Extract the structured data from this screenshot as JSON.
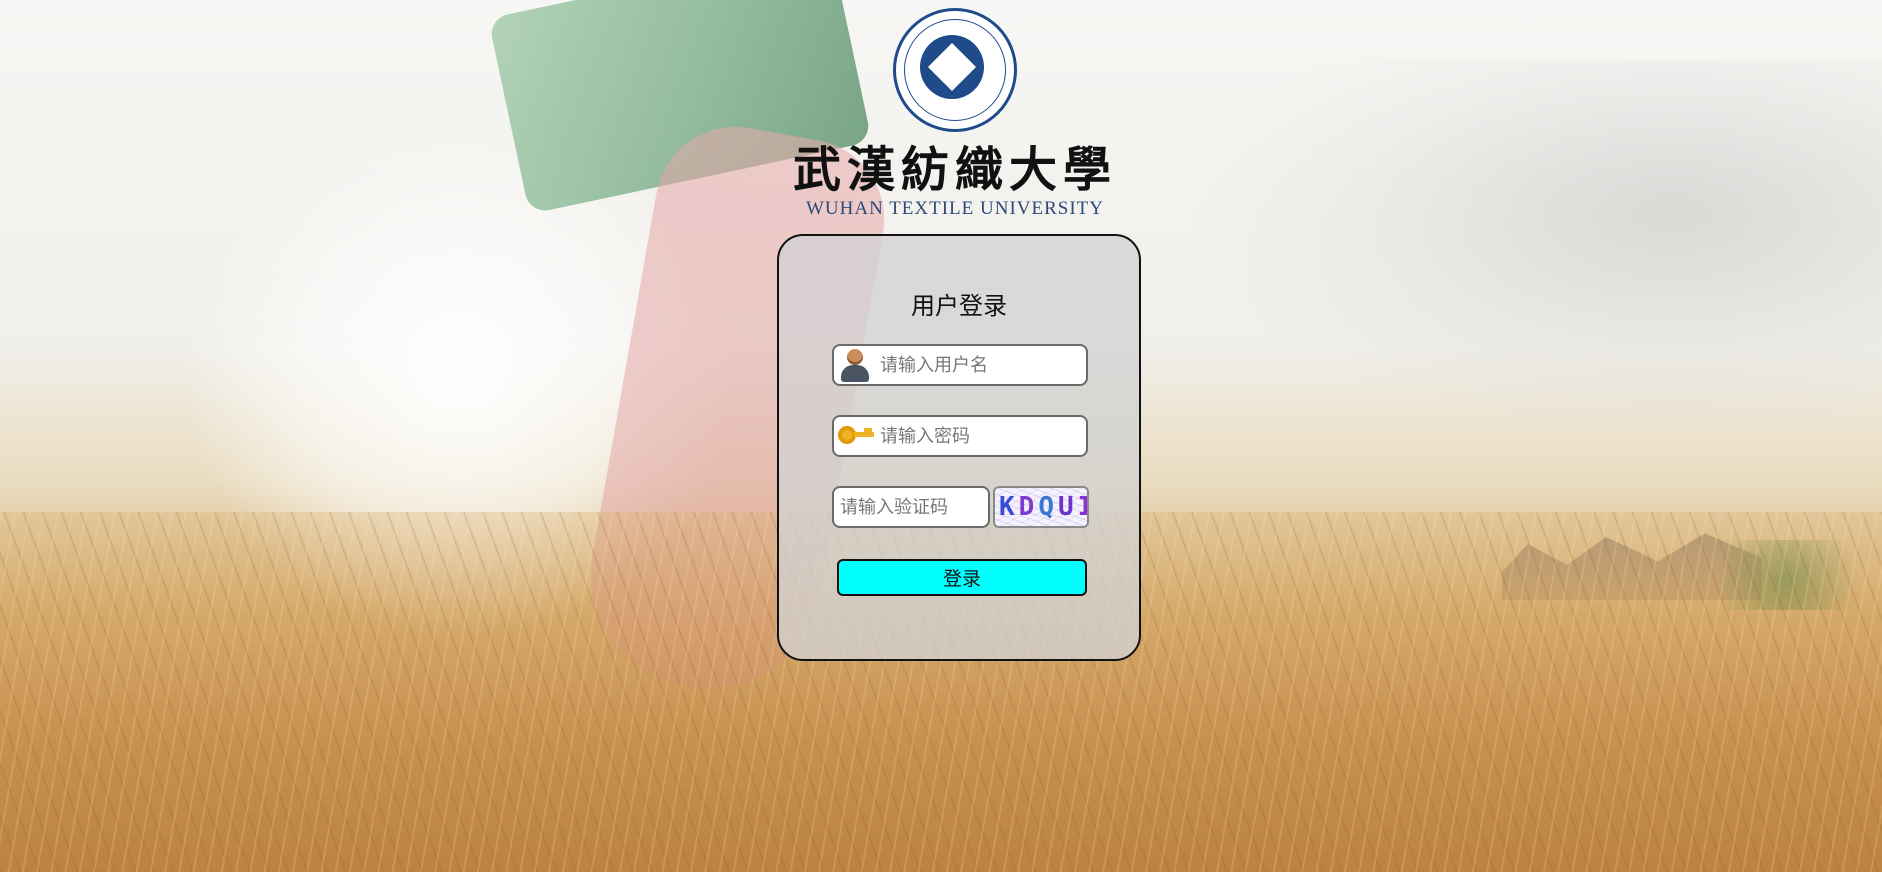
{
  "university": {
    "name_cn": "武漢紡織大學",
    "name_en": "WUHAN TEXTILE UNIVERSITY"
  },
  "login": {
    "title": "用户登录",
    "username_placeholder": "请输入用户名",
    "password_placeholder": "请输入密码",
    "captcha_placeholder": "请输入验证码",
    "captcha_chars": [
      "K",
      "D",
      "Q",
      "U",
      "I"
    ],
    "submit_label": "登录"
  },
  "colors": {
    "button": "#00ffff",
    "seal_blue": "#1f4b8a"
  }
}
